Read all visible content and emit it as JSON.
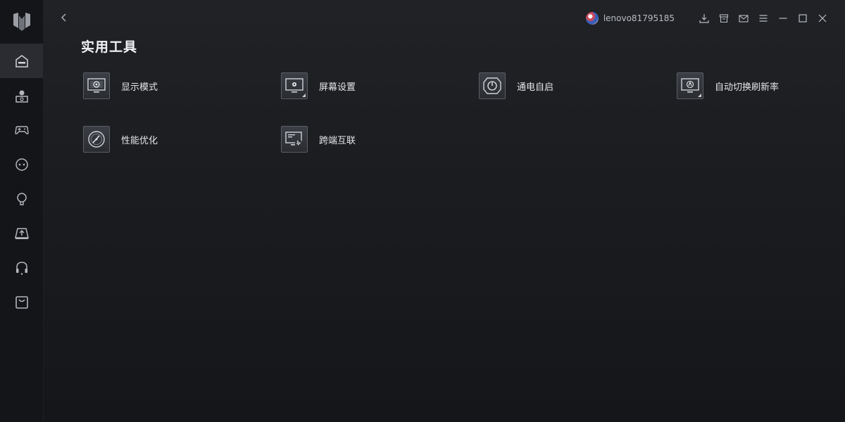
{
  "header": {
    "username": "lenovo81795185"
  },
  "page": {
    "title": "实用工具"
  },
  "sidebar": {
    "items": [
      {
        "name": "home",
        "icon": "home-icon"
      },
      {
        "name": "profile",
        "icon": "user-card-icon"
      },
      {
        "name": "game",
        "icon": "gamepad-icon"
      },
      {
        "name": "chat",
        "icon": "chat-icon"
      },
      {
        "name": "light",
        "icon": "bulb-icon"
      },
      {
        "name": "upload",
        "icon": "upload-icon"
      },
      {
        "name": "support",
        "icon": "headset-icon"
      },
      {
        "name": "store",
        "icon": "shopping-bag-icon"
      }
    ]
  },
  "tools": [
    {
      "label": "显示模式",
      "icon": "display-mode-icon"
    },
    {
      "label": "屏幕设置",
      "icon": "screen-settings-icon"
    },
    {
      "label": "通电自启",
      "icon": "power-on-icon"
    },
    {
      "label": "自动切换刷新率",
      "icon": "refresh-rate-icon"
    },
    {
      "label": "性能优化",
      "icon": "performance-gauge-icon"
    },
    {
      "label": "跨端互联",
      "icon": "cross-device-link-icon"
    }
  ],
  "colors": {
    "background": "#1a1c20",
    "sidebar": "#141518",
    "active_nav": "#2a2c31",
    "text": "#e4e6ea"
  }
}
